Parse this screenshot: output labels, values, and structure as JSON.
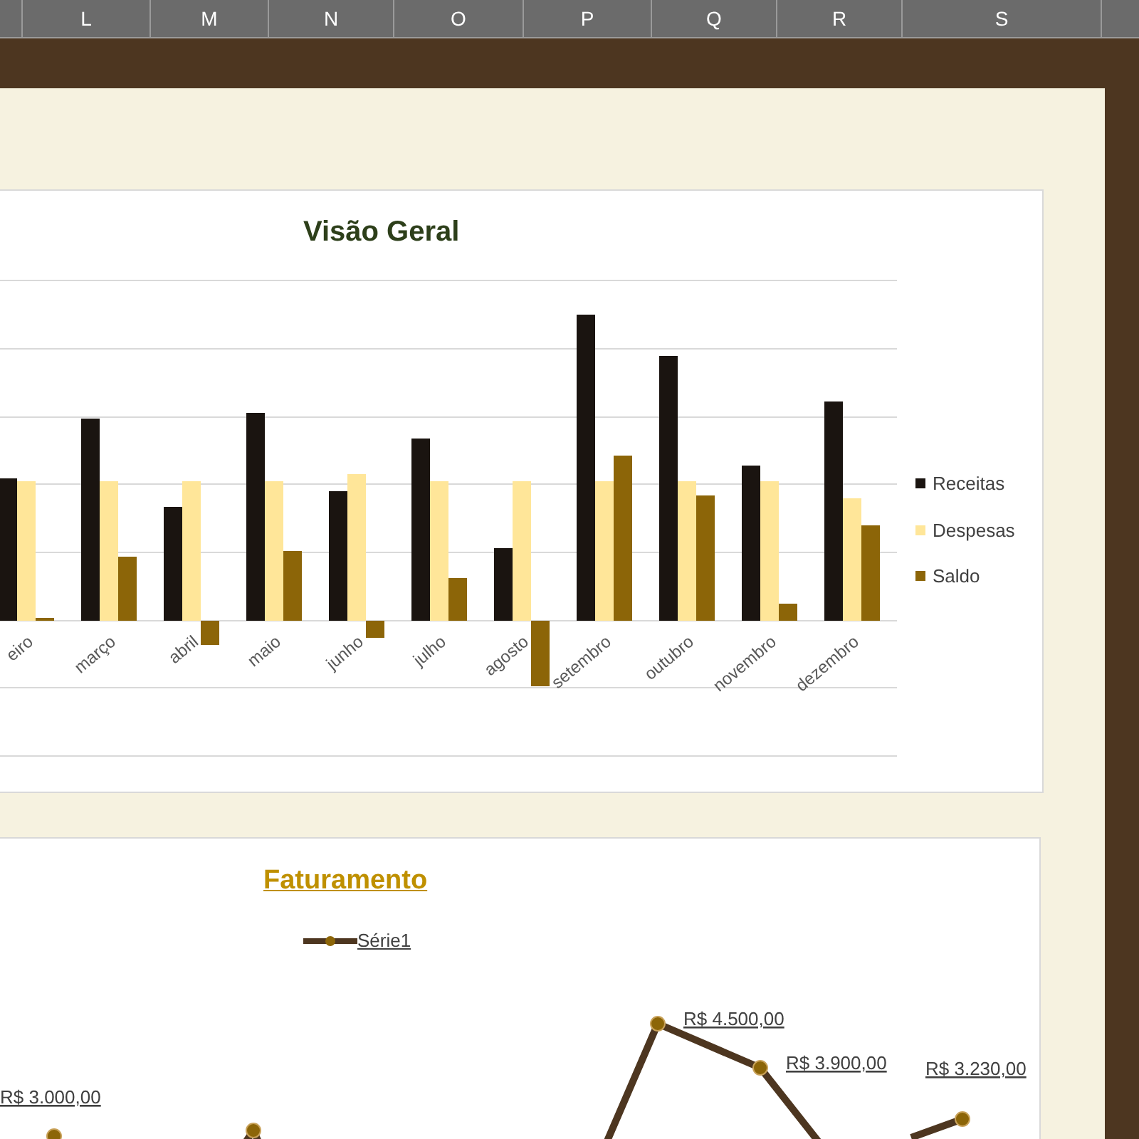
{
  "column_headers": [
    "L",
    "M",
    "N",
    "O",
    "P",
    "Q",
    "R",
    "S"
  ],
  "overview_chart": {
    "title": "Visão Geral",
    "categories": [
      "eiro",
      "março",
      "abril",
      "maio",
      "junho",
      "julho",
      "agosto",
      "setembro",
      "outubro",
      "novembro",
      "dezembro"
    ],
    "legend": [
      {
        "name": "Receitas",
        "color": "#1a1410"
      },
      {
        "name": "Despesas",
        "color": "#ffe699"
      },
      {
        "name": "Saldo",
        "color": "#8c6508"
      }
    ]
  },
  "revenue_chart": {
    "title": "Faturamento",
    "legend": "Série1",
    "data_labels": [
      "R$ 3.000,00",
      "R$ 4.500,00",
      "R$ 3.900,00",
      "R$ 3.230,00"
    ]
  }
}
